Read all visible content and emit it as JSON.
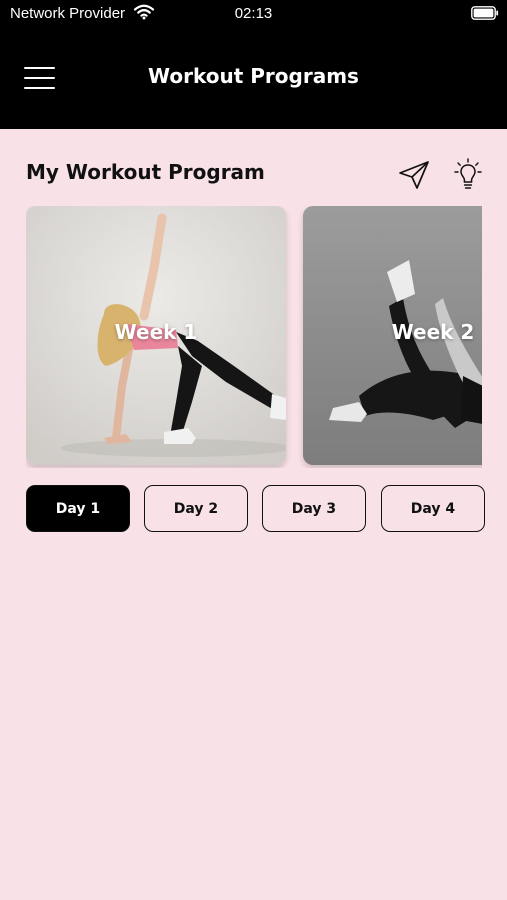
{
  "status_bar": {
    "carrier": "Network Provider",
    "time": "02:13"
  },
  "header": {
    "title": "Workout Programs",
    "menu_icon": "hamburger-menu-icon"
  },
  "section": {
    "title": "My Workout Program",
    "icons": [
      "paper-plane-icon",
      "lightbulb-icon"
    ]
  },
  "weeks": [
    {
      "label": "Week 1"
    },
    {
      "label": "Week 2"
    }
  ],
  "days": [
    {
      "label": "Day 1",
      "selected": true
    },
    {
      "label": "Day 2",
      "selected": false
    },
    {
      "label": "Day 3",
      "selected": false
    },
    {
      "label": "Day 4",
      "selected": false
    }
  ],
  "colors": {
    "header_bg": "#000000",
    "page_bg": "#f8e1e7",
    "accent_pink": "#e9869b",
    "selected_day_bg": "#000000"
  }
}
